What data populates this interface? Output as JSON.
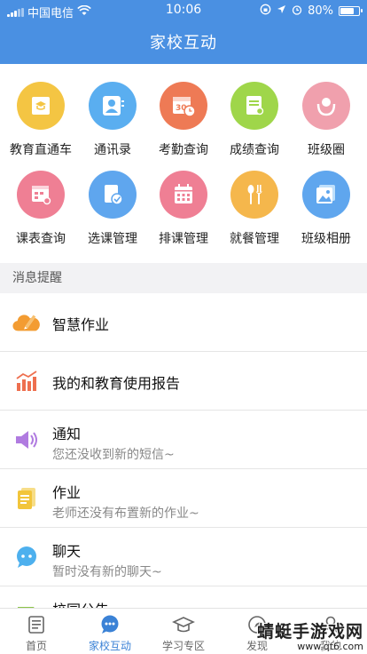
{
  "status_bar": {
    "carrier": "中国电信",
    "time": "10:06",
    "battery": "80%",
    "battery_level": 0.8
  },
  "header": {
    "title": "家校互动"
  },
  "apps": [
    {
      "label": "教育直通车",
      "icon": "graduation-book-icon",
      "color": "#f4c543"
    },
    {
      "label": "通讯录",
      "icon": "contacts-person-icon",
      "color": "#5aaef0"
    },
    {
      "label": "考勤查询",
      "icon": "calendar-clock-icon",
      "color": "#ee7a55"
    },
    {
      "label": "成绩查询",
      "icon": "report-search-icon",
      "color": "#9fd64a"
    },
    {
      "label": "班级圈",
      "icon": "class-circle-icon",
      "color": "#f0a0ad"
    },
    {
      "label": "课表查询",
      "icon": "schedule-search-icon",
      "color": "#ef7f94"
    },
    {
      "label": "选课管理",
      "icon": "course-check-icon",
      "color": "#5fa6ee"
    },
    {
      "label": "排课管理",
      "icon": "calendar-grid-icon",
      "color": "#ef7f94"
    },
    {
      "label": "就餐管理",
      "icon": "spoon-fork-icon",
      "color": "#f5b74c"
    },
    {
      "label": "班级相册",
      "icon": "photo-album-icon",
      "color": "#5fa6ee"
    }
  ],
  "section": {
    "title": "消息提醒"
  },
  "messages": [
    {
      "title": "智慧作业",
      "subtitle": "",
      "icon": "cloud-pencil-icon",
      "color": "#f39c32"
    },
    {
      "title": "我的和教育使用报告",
      "subtitle": "",
      "icon": "bar-chart-icon",
      "color": "#ee6f4f"
    },
    {
      "title": "通知",
      "subtitle": "您还没收到新的短信~",
      "icon": "speaker-icon",
      "color": "#b07be0"
    },
    {
      "title": "作业",
      "subtitle": "老师还没有布置新的作业~",
      "icon": "homework-doc-icon",
      "color": "#f2c53b"
    },
    {
      "title": "聊天",
      "subtitle": "暂时没有新的聊天~",
      "icon": "chat-bubble-icon",
      "color": "#4db0ee"
    },
    {
      "title": "校园公告",
      "subtitle": "",
      "icon": "announcement-icon",
      "color": "#8cc44a"
    }
  ],
  "tabs": [
    {
      "label": "首页",
      "icon": "home-doc-icon",
      "active": false
    },
    {
      "label": "家校互动",
      "icon": "chat-icon",
      "active": true
    },
    {
      "label": "学习专区",
      "icon": "graduation-cap-icon",
      "active": false
    },
    {
      "label": "发现",
      "icon": "compass-icon",
      "active": false
    },
    {
      "label": "我的",
      "icon": "person-icon",
      "active": false
    }
  ],
  "watermark": {
    "line1": "蜻蜓手游戏网",
    "line2": "www.qt6.com"
  },
  "colors": {
    "header_blue": "#4a90e2",
    "active_tab": "#3b82d6"
  }
}
